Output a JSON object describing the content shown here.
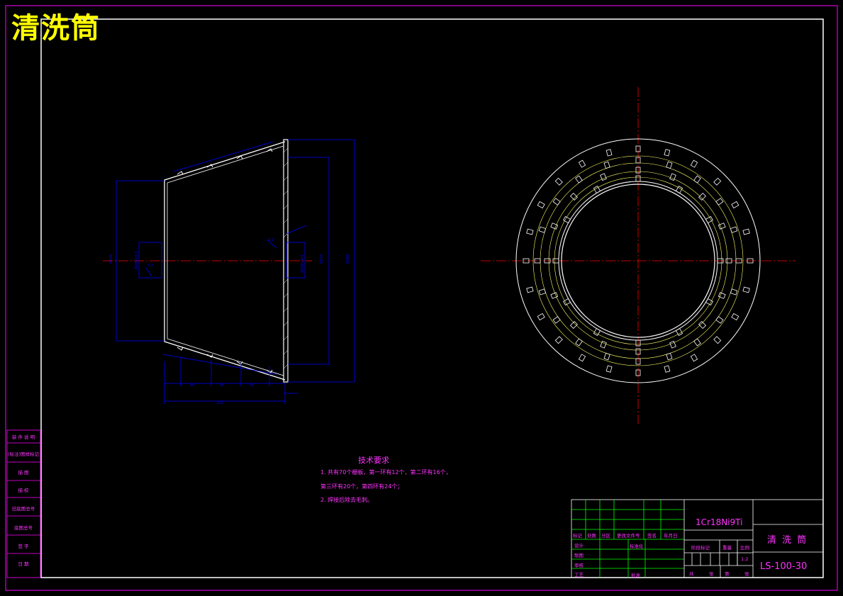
{
  "drawing": {
    "title": "清洗筒",
    "material": "1Cr18Ni9Ti",
    "part_name": "清 洗 筒",
    "drawing_number": "LS-100-30",
    "scale": "1:2"
  },
  "tech_requirements": {
    "heading": "技术要求",
    "lines": [
      "1. 共有70个栅板，第一环有12个，第二环有16个，",
      "第三环有20个，第四环有24个；",
      "2. 焊接后除去毛刺。"
    ]
  },
  "side_labels": [
    "装 件 说 明",
    "(标注)图样标记",
    "描 图",
    "描 校",
    "旧底图总号",
    "底图总号",
    "签 字",
    "日 期"
  ],
  "title_block": {
    "rev_headers": [
      "标记",
      "处数",
      "分区",
      "更改文件号",
      "签名",
      "年月日"
    ],
    "roles": [
      "设计",
      "制图",
      "审核",
      "工艺"
    ],
    "standardize": "标准化",
    "approve": "批准",
    "stage_mark": "阶段标记",
    "weight": "重量",
    "ratio": "比例",
    "sheet_labels": [
      "共",
      "张",
      "第",
      "张"
    ]
  },
  "colors": {
    "frame": "#ff00ff",
    "outline": "#ffffff",
    "dimension": "#0000ff",
    "centerline": "#ff0000",
    "hidden": "#ffff00",
    "annotation": "#ff33ff"
  }
}
